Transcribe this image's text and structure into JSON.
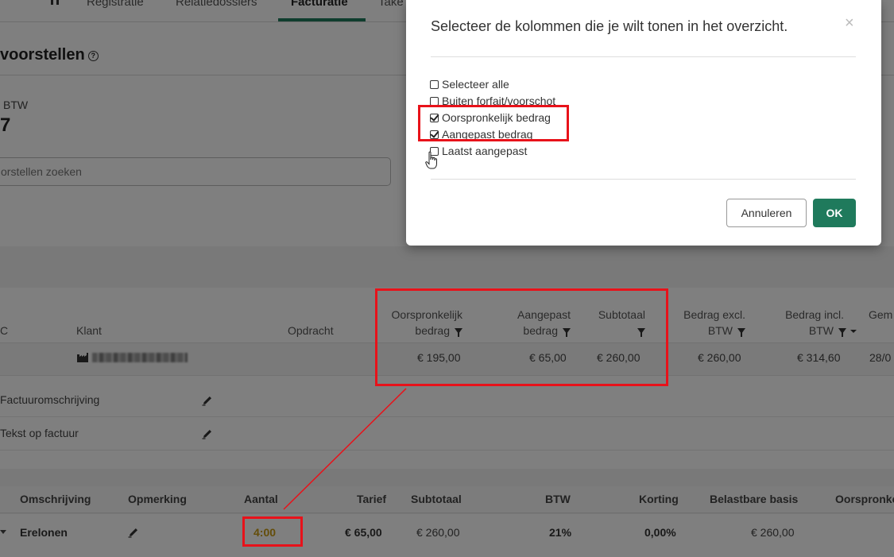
{
  "nav": {
    "tabs": [
      "Registratie",
      "Relatiedossiers",
      "Facturatie",
      "Take"
    ],
    "active_tab": "Facturatie"
  },
  "page": {
    "title": "voorstellen",
    "kpi_label": "BTW",
    "kpi_value": "7",
    "search_placeholder": "orstellen zoeken"
  },
  "table": {
    "headers": {
      "c": "C",
      "klant": "Klant",
      "opdracht": "Opdracht",
      "oorspronkelijk_line1": "Oorspronkelijk",
      "oorspronkelijk_line2": "bedrag",
      "aangepast_line1": "Aangepast",
      "aangepast_line2": "bedrag",
      "subtotaal": "Subtotaal",
      "excl_line1": "Bedrag excl.",
      "excl_line2": "BTW",
      "incl_line1": "Bedrag incl.",
      "incl_line2": "BTW",
      "gem": "Gem"
    },
    "row": {
      "oorspronkelijk": "€ 195,00",
      "aangepast": "€ 65,00",
      "subtotaal": "€ 260,00",
      "excl": "€ 260,00",
      "incl": "€ 314,60",
      "date": "28/0"
    }
  },
  "descriptions": {
    "factuuromschrijving": "Factuuromschrijving",
    "tekst_op_factuur": "Tekst op factuur"
  },
  "lines": {
    "headers": {
      "omschrijving": "Omschrijving",
      "opmerking": "Opmerking",
      "aantal": "Aantal",
      "tarief": "Tarief",
      "subtotaal": "Subtotaal",
      "btw": "BTW",
      "korting": "Korting",
      "belastbare_basis": "Belastbare basis",
      "oorspronkelijk": "Oorspronke"
    },
    "row": {
      "omschrijving": "Erelonen",
      "aantal": "4:00",
      "tarief": "€ 65,00",
      "subtotaal": "€ 260,00",
      "btw": "21%",
      "korting": "0,00%",
      "belastbare_basis": "€ 260,00"
    }
  },
  "modal": {
    "title": "Selecteer de kolommen die je wilt tonen in het overzicht.",
    "close": "×",
    "options": [
      {
        "label": "Selecteer alle",
        "checked": false
      },
      {
        "label": "Buiten forfait/voorschot",
        "checked": false
      },
      {
        "label": "Oorspronkelijk bedrag",
        "checked": true
      },
      {
        "label": "Aangepast bedrag",
        "checked": true
      },
      {
        "label": "Laatst aangepast",
        "checked": false
      }
    ],
    "cancel_label": "Annuleren",
    "ok_label": "OK"
  },
  "colors": {
    "accent": "#1f7a5c",
    "annotation": "#e8121a",
    "amber": "#c99a12"
  },
  "icons": [
    "help-icon",
    "filter-icon",
    "pencil-icon",
    "client-icon",
    "close-icon",
    "hand-cursor-icon",
    "checkbox-icon"
  ]
}
